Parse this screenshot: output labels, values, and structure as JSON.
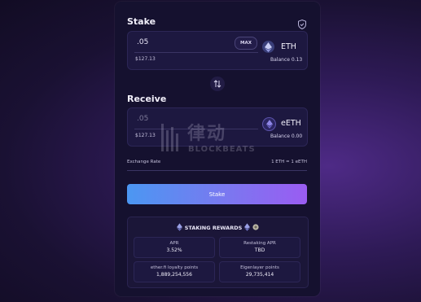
{
  "colors": {
    "background": "#1a1133",
    "card": "#15112f",
    "panel": "#1d1840",
    "accent_start": "#4b97f2",
    "accent_end": "#9a5cf2"
  },
  "stake": {
    "title": "Stake",
    "amount": ".05",
    "max_label": "MAX",
    "usd_value": "$127.13",
    "token": "ETH",
    "balance": "Balance 0.13",
    "header_icon": "shield-icon",
    "token_icon": "ethereum-icon"
  },
  "swap": {
    "icon": "swap-arrows-icon"
  },
  "receive": {
    "title": "Receive",
    "amount": ".05",
    "usd_value": "$127.13",
    "token": "eETH",
    "balance": "Balance 0.00",
    "token_icon": "eeth-icon"
  },
  "exchange": {
    "label": "Exchange Rate",
    "value": "1 ETH = 1 eETH"
  },
  "stake_button": {
    "label": "Stake"
  },
  "rewards": {
    "title": "STAKING REWARDS",
    "stats": [
      {
        "label": "APR",
        "value": "3.52%"
      },
      {
        "label": "Restaking APR",
        "value": "TBD"
      },
      {
        "label": "ether.fi loyalty points",
        "value": "1,889,254,556"
      },
      {
        "label": "Eigenlayer points",
        "value": "29,735,414"
      }
    ]
  },
  "watermark": {
    "cn": "律动",
    "en": "BLOCKBEATS"
  }
}
